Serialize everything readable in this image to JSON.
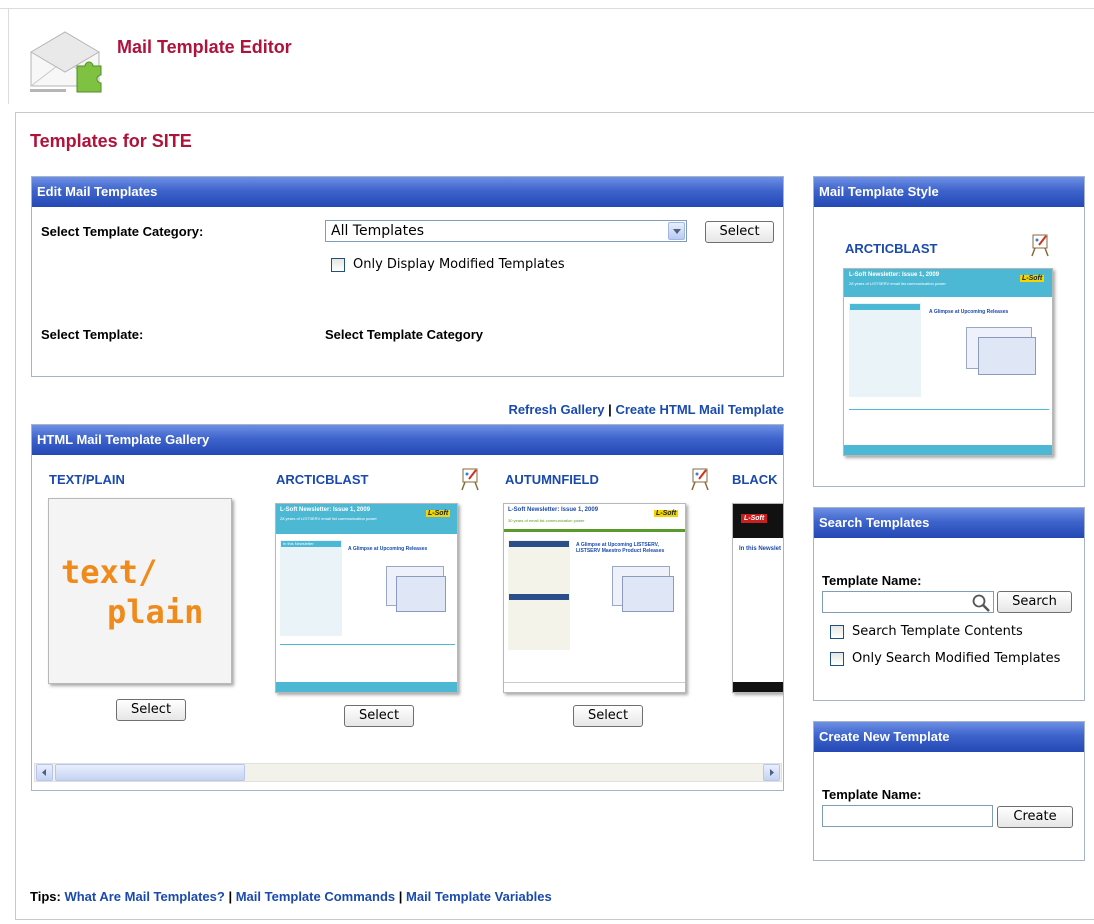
{
  "header": {
    "app_title": "Mail Template Editor"
  },
  "page_title": "Templates for SITE",
  "edit_panel": {
    "title": "Edit Mail Templates",
    "category_label": "Select Template Category:",
    "category_value": "All Templates",
    "select_button": "Select",
    "modified_only_label": "Only Display Modified Templates",
    "template_label": "Select Template:",
    "template_value": "Select Template Category"
  },
  "gallery_links": {
    "refresh": "Refresh Gallery",
    "separator": "|",
    "create": "Create HTML Mail Template"
  },
  "gallery": {
    "title": "HTML Mail Template Gallery",
    "items": [
      {
        "name": "TEXT/PLAIN",
        "preview_line1": "text/",
        "preview_line2": "plain",
        "select_label": "Select"
      },
      {
        "name": "ARCTICBLAST",
        "select_label": "Select"
      },
      {
        "name": "AUTUMNFIELD",
        "select_label": "Select"
      },
      {
        "name": "BLACK"
      }
    ],
    "thumb_text": {
      "newsletter_title": "L-Soft Newsletter: Issue 1, 2009",
      "arctic_subtitle": "28 years of LISTSERV email list communication power",
      "autumn_subtitle": "30 years of email list communication power",
      "arctic_heading": "A Glimpse at Upcoming Releases",
      "autumn_heading": "A Glimpse at Upcoming LISTSERV, LISTSERV Maestro Product Releases",
      "sidebar_heading": "In this Newsletter",
      "black_heading": "In this Newslet",
      "logo": "L-Soft"
    }
  },
  "style_panel": {
    "title": "Mail Template Style",
    "current_style": "ARCTICBLAST"
  },
  "search_panel": {
    "title": "Search Templates",
    "name_label": "Template Name:",
    "search_value": "",
    "search_button": "Search",
    "contents_label": "Search Template Contents",
    "modified_label": "Only Search Modified Templates"
  },
  "create_panel": {
    "title": "Create New Template",
    "name_label": "Template Name:",
    "name_value": "",
    "create_button": "Create"
  },
  "tips": {
    "label": "Tips:",
    "links": [
      "What Are Mail Templates?",
      "Mail Template Commands",
      "Mail Template Variables"
    ],
    "separator": "|"
  },
  "colors": {
    "title_red": "#b0123a",
    "link_blue": "#1a4aae",
    "panel_head": "#3e64cc",
    "orange": "#f08a1a"
  },
  "icons": [
    "mail-puzzle-logo-icon",
    "easel-edit-icon",
    "magnifier-icon",
    "scroll-left-icon",
    "scroll-right-icon"
  ]
}
